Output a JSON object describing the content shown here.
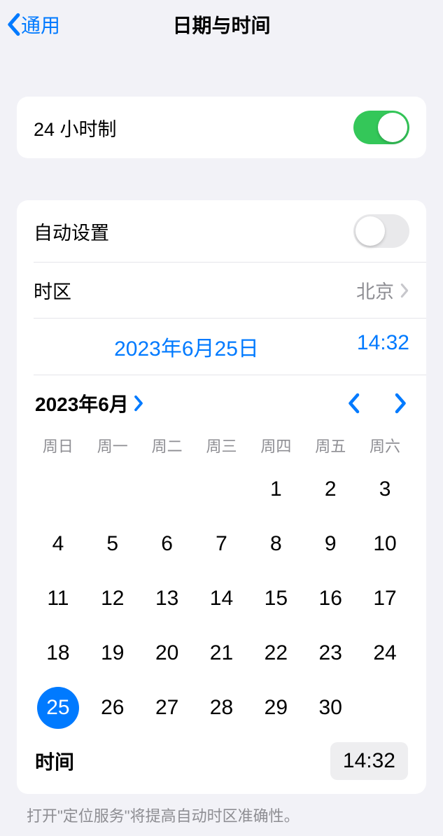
{
  "nav": {
    "back": "通用",
    "title": "日期与时间"
  },
  "s24h": {
    "label": "24 小时制",
    "on": true
  },
  "auto": {
    "label": "自动设置",
    "on": false
  },
  "tz": {
    "label": "时区",
    "value": "北京"
  },
  "dt": {
    "date": "2023年6月25日",
    "time": "14:32"
  },
  "cal": {
    "month": "2023年6月",
    "weekdays": [
      "周日",
      "周一",
      "周二",
      "周三",
      "周四",
      "周五",
      "周六"
    ],
    "startOffset": 4,
    "daysInMonth": 30,
    "selected": 25,
    "timeLabel": "时间",
    "timeValue": "14:32"
  },
  "footer": "打开\"定位服务\"将提高自动时区准确性。"
}
